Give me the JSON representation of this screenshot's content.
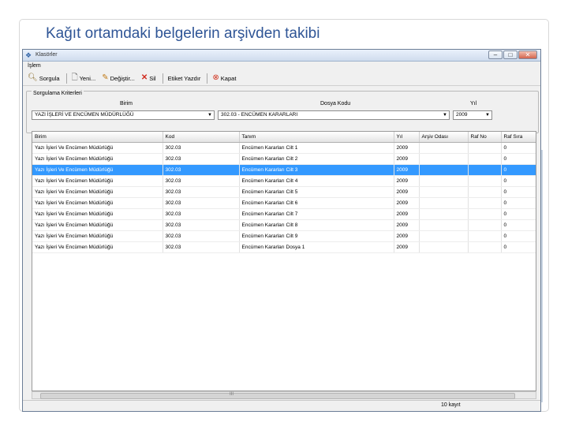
{
  "slide": {
    "title": "Kağıt ortamdaki belgelerin arşivden takibi"
  },
  "window": {
    "title": "Klasörler",
    "controls": {
      "minimize": "–",
      "maximize": "□",
      "close": "✕"
    }
  },
  "menu": {
    "items": [
      "İşlem"
    ]
  },
  "toolbar": {
    "search": "Sorgula",
    "new": "Yeni...",
    "edit": "Değiştir...",
    "delete": "Sil",
    "print": "Etiket Yazdır",
    "close": "Kapat"
  },
  "criteria": {
    "legend": "Sorgulama Kriterleri",
    "unit_label": "Birim",
    "unit_value": "YAZI İŞLERİ VE ENCÜMEN MÜDÜRLÜĞÜ",
    "file_code_label": "Dosya Kodu",
    "file_code_value": "302.03 - ENCÜMEN KARARLARI",
    "year_label": "Yıl",
    "year_value": "2009"
  },
  "table": {
    "columns": [
      "Birim",
      "Kod",
      "Tanım",
      "Yıl",
      "Arşiv Odası",
      "Raf No",
      "Raf Sıra"
    ],
    "rows": [
      [
        "Yazı İşleri Ve Encümen Müdürlüğü",
        "302.03",
        "Encümen Kararları Cilt 1",
        "2009",
        "",
        "",
        "0"
      ],
      [
        "Yazı İşleri Ve Encümen Müdürlüğü",
        "302.03",
        "Encümen Kararları Cilt 2",
        "2009",
        "",
        "",
        "0"
      ],
      [
        "Yazı İşleri Ve Encümen Müdürlüğü",
        "302.03",
        "Encümen Kararları Cilt 3",
        "2009",
        "",
        "",
        "0"
      ],
      [
        "Yazı İşleri Ve Encümen Müdürlüğü",
        "302.03",
        "Encümen Kararları Cilt 4",
        "2009",
        "",
        "",
        "0"
      ],
      [
        "Yazı İşleri Ve Encümen Müdürlüğü",
        "302.03",
        "Encümen Kararları Cilt 5",
        "2009",
        "",
        "",
        "0"
      ],
      [
        "Yazı İşleri Ve Encümen Müdürlüğü",
        "302.03",
        "Encümen Kararları Cilt 6",
        "2009",
        "",
        "",
        "0"
      ],
      [
        "Yazı İşleri Ve Encümen Müdürlüğü",
        "302.03",
        "Encümen Kararları Cilt 7",
        "2009",
        "",
        "",
        "0"
      ],
      [
        "Yazı İşleri Ve Encümen Müdürlüğü",
        "302.03",
        "Encümen Kararları Cilt 8",
        "2009",
        "",
        "",
        "0"
      ],
      [
        "Yazı İşleri Ve Encümen Müdürlüğü",
        "302.03",
        "Encümen Kararları Cilt 9",
        "2009",
        "",
        "",
        "0"
      ],
      [
        "Yazı İşleri Ve Encümen Müdürlüğü",
        "302.03",
        "Encümen Kararları Dosya 1",
        "2009",
        "",
        "",
        "0"
      ]
    ],
    "selected_row": 2
  },
  "status": {
    "record_count": "10 kayıt"
  },
  "scrollbar": {
    "grip": "III"
  }
}
